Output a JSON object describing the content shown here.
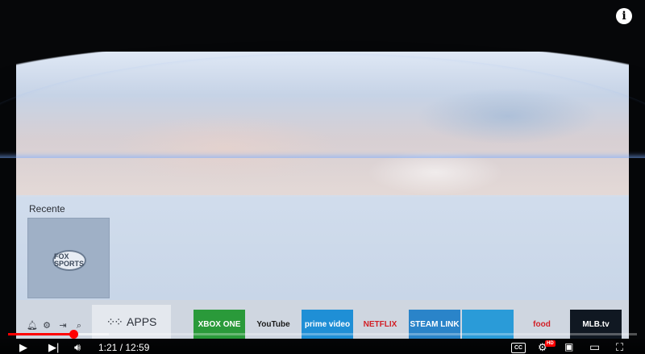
{
  "tv_ui": {
    "recent_title": "Recente",
    "recent_tile_logo": "FOX SPORTS",
    "quick_icons": [
      "bell-icon",
      "gear-icon",
      "input-source-icon",
      "search-icon"
    ],
    "apps_label": "APPS",
    "apps": [
      {
        "name": "xbox-one",
        "label": "XBOX ONE",
        "bg": "#2a9a3a",
        "fg": "#ffffff"
      },
      {
        "name": "youtube",
        "label": "YouTube",
        "bg": "#cfd6e0",
        "fg": "#1a1a1a"
      },
      {
        "name": "prime-video",
        "label": "prime video",
        "bg": "#1f8fd6",
        "fg": "#ffffff"
      },
      {
        "name": "netflix",
        "label": "NETFLIX",
        "bg": "#cfd6e0",
        "fg": "#d21f26"
      },
      {
        "name": "steam-link",
        "label": "STEAM LINK",
        "bg": "#2a84c9",
        "fg": "#ffffff"
      },
      {
        "name": "cast-app",
        "label": "",
        "bg": "#2a9bd8",
        "fg": "#ffffff"
      },
      {
        "name": "food-network",
        "label": "food",
        "bg": "#cfd6e0",
        "fg": "#d21f26"
      },
      {
        "name": "mlb-tv",
        "label": "MLB.tv",
        "bg": "#101822",
        "fg": "#ffffff"
      }
    ]
  },
  "player": {
    "time_current": "1:21",
    "time_total": "12:59",
    "time_display": "1:21 / 12:59",
    "progress_fraction": 0.104,
    "buffer_fraction": 0.16,
    "cc_label": "CC",
    "hd_badge": "HD",
    "info_icon": "i",
    "accent": "#ff0000"
  }
}
